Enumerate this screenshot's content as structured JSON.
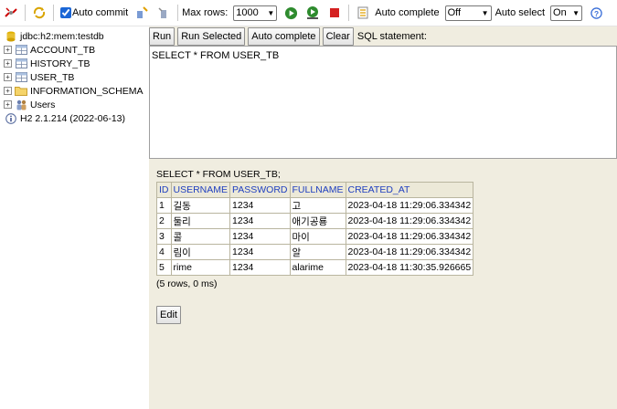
{
  "toolbar": {
    "auto_commit_label": "Auto commit",
    "auto_commit_checked": true,
    "max_rows_label": "Max rows:",
    "max_rows_value": "1000",
    "auto_complete_label": "Auto complete",
    "auto_complete_value": "Off",
    "auto_select_label": "Auto select",
    "auto_select_value": "On",
    "help_glyph": "?"
  },
  "tree": {
    "connection": "jdbc:h2:mem:testdb",
    "tables": [
      "ACCOUNT_TB",
      "HISTORY_TB",
      "USER_TB"
    ],
    "schema": "INFORMATION_SCHEMA",
    "users": "Users",
    "version": "H2 2.1.214 (2022-06-13)"
  },
  "editor": {
    "run": "Run",
    "run_selected": "Run Selected",
    "auto_complete": "Auto complete",
    "clear": "Clear",
    "sql_label": "SQL statement:",
    "sql_text": "SELECT * FROM USER_TB"
  },
  "result": {
    "title": "SELECT * FROM USER_TB;",
    "columns": [
      "ID",
      "USERNAME",
      "PASSWORD",
      "FULLNAME",
      "CREATED_AT"
    ],
    "rows": [
      [
        "1",
        "길동",
        "1234",
        "고",
        "2023-04-18 11:29:06.334342"
      ],
      [
        "2",
        "둘리",
        "1234",
        "애기공룡",
        "2023-04-18 11:29:06.334342"
      ],
      [
        "3",
        "콜",
        "1234",
        "마이",
        "2023-04-18 11:29:06.334342"
      ],
      [
        "4",
        "림이",
        "1234",
        "알",
        "2023-04-18 11:29:06.334342"
      ],
      [
        "5",
        "rime",
        "1234",
        "alarime",
        "2023-04-18 11:30:35.926665"
      ]
    ],
    "footer": "(5 rows, 0 ms)",
    "edit": "Edit"
  },
  "colors": {
    "panel_bg": "#f0ede0",
    "header_text": "#1f3fbf",
    "run_green": "#2e8b2e",
    "stop_red": "#d42020"
  }
}
